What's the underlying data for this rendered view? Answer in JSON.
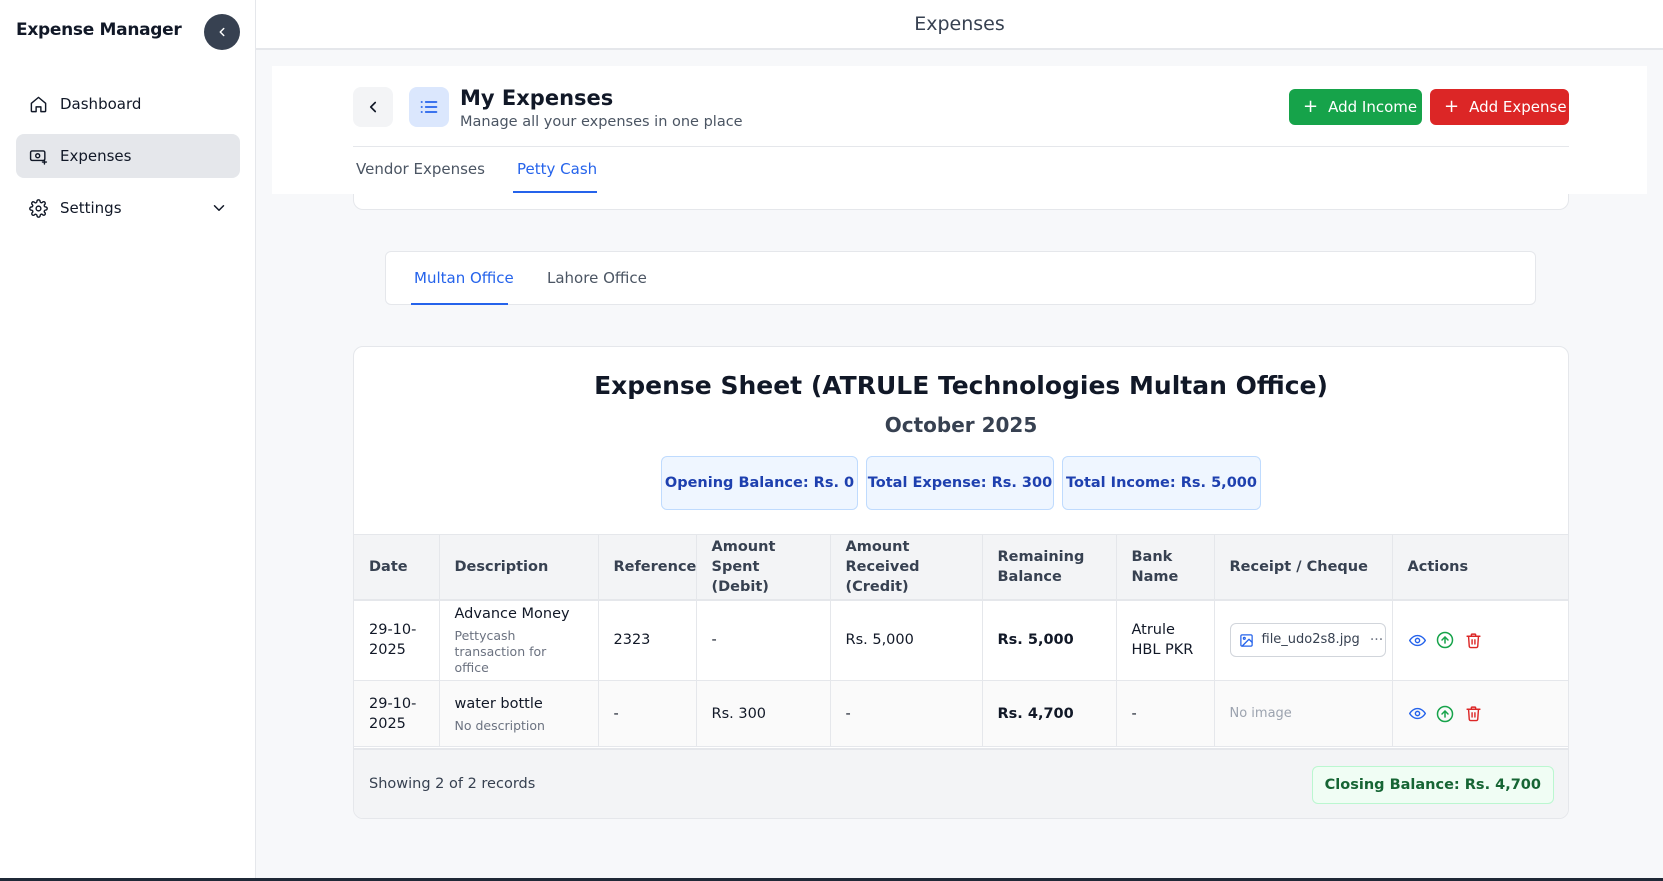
{
  "sidebar": {
    "brand": "Expense Manager",
    "items": [
      {
        "label": "Dashboard",
        "icon": "home-icon"
      },
      {
        "label": "Expenses",
        "icon": "money-icon"
      },
      {
        "label": "Settings",
        "icon": "gear-icon"
      }
    ]
  },
  "topbar": {
    "title": "Expenses"
  },
  "header": {
    "title": "My Expenses",
    "subtitle": "Manage all your expenses in one place",
    "add_income_label": "Add Income",
    "add_expense_label": "Add Expense",
    "tabs": [
      {
        "label": "Vendor Expenses"
      },
      {
        "label": "Petty Cash"
      }
    ],
    "active_tab": "Petty Cash"
  },
  "office_tabs": [
    {
      "label": "Multan Office"
    },
    {
      "label": "Lahore Office"
    }
  ],
  "active_office": "Multan Office",
  "sheet": {
    "title": "Expense Sheet (ATRULE Technologies Multan Office)",
    "month": "October 2025",
    "opening_balance": "Opening Balance: Rs. 0",
    "total_expense": "Total Expense: Rs. 300",
    "total_income": "Total Income: Rs. 5,000",
    "columns": [
      "Date",
      "Description",
      "Reference",
      "Amount Spent (Debit)",
      "Amount Received (Credit)",
      "Remaining Balance",
      "Bank Name",
      "Receipt / Cheque",
      "Actions"
    ],
    "rows": [
      {
        "date": "29-10-2025",
        "desc_title": "Advance Money",
        "desc_sub": "Pettycash transaction for office",
        "reference": "2323",
        "debit": "-",
        "credit": "Rs. 5,000",
        "remaining": "Rs. 5,000",
        "bank": "Atrule HBL PKR",
        "receipt": "file_udo2s8.jpg",
        "receipt_more": "···"
      },
      {
        "date": "29-10-2025",
        "desc_title": "water bottle",
        "desc_sub": "No description",
        "reference": "-",
        "debit": "Rs. 300",
        "credit": "-",
        "remaining": "Rs. 4,700",
        "bank": "-",
        "receipt": "No image"
      }
    ],
    "showing": "Showing 2 of 2 records",
    "closing_balance": "Closing Balance: Rs. 4,700"
  },
  "colors": {
    "accent": "#2563eb",
    "income_green": "#16a34a",
    "expense_red": "#dc2626",
    "sidebar_active": "#e5e7eb"
  }
}
